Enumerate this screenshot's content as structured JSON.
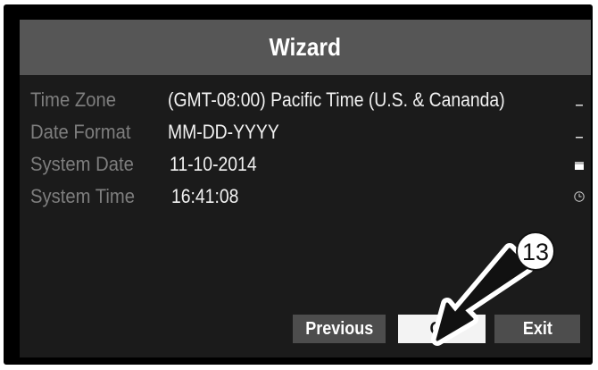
{
  "dialog": {
    "title": "Wizard",
    "rows": [
      {
        "label": "Time Zone",
        "value": "(GMT-08:00) Pacific Time (U.S. & Cananda)",
        "icon": "dropdown-icon"
      },
      {
        "label": "Date Format",
        "value": "MM-DD-YYYY",
        "icon": "dropdown-icon"
      },
      {
        "label": "System Date",
        "value": "11-10-2014",
        "icon": "calendar-icon"
      },
      {
        "label": "System Time",
        "value": "16:41:08",
        "icon": "clock-icon"
      }
    ],
    "buttons": {
      "previous": "Previous",
      "ok": "OK",
      "exit": "Exit"
    }
  },
  "annotation": {
    "step_number": "13"
  },
  "colors": {
    "title_bar": "#565656",
    "dialog_bg": "#1b1b1b",
    "label_text": "#7e7e7e",
    "value_text": "#f2f2f2",
    "button_bg": "#4d4d4d",
    "ok_button_bg": "#f3f3f3"
  }
}
